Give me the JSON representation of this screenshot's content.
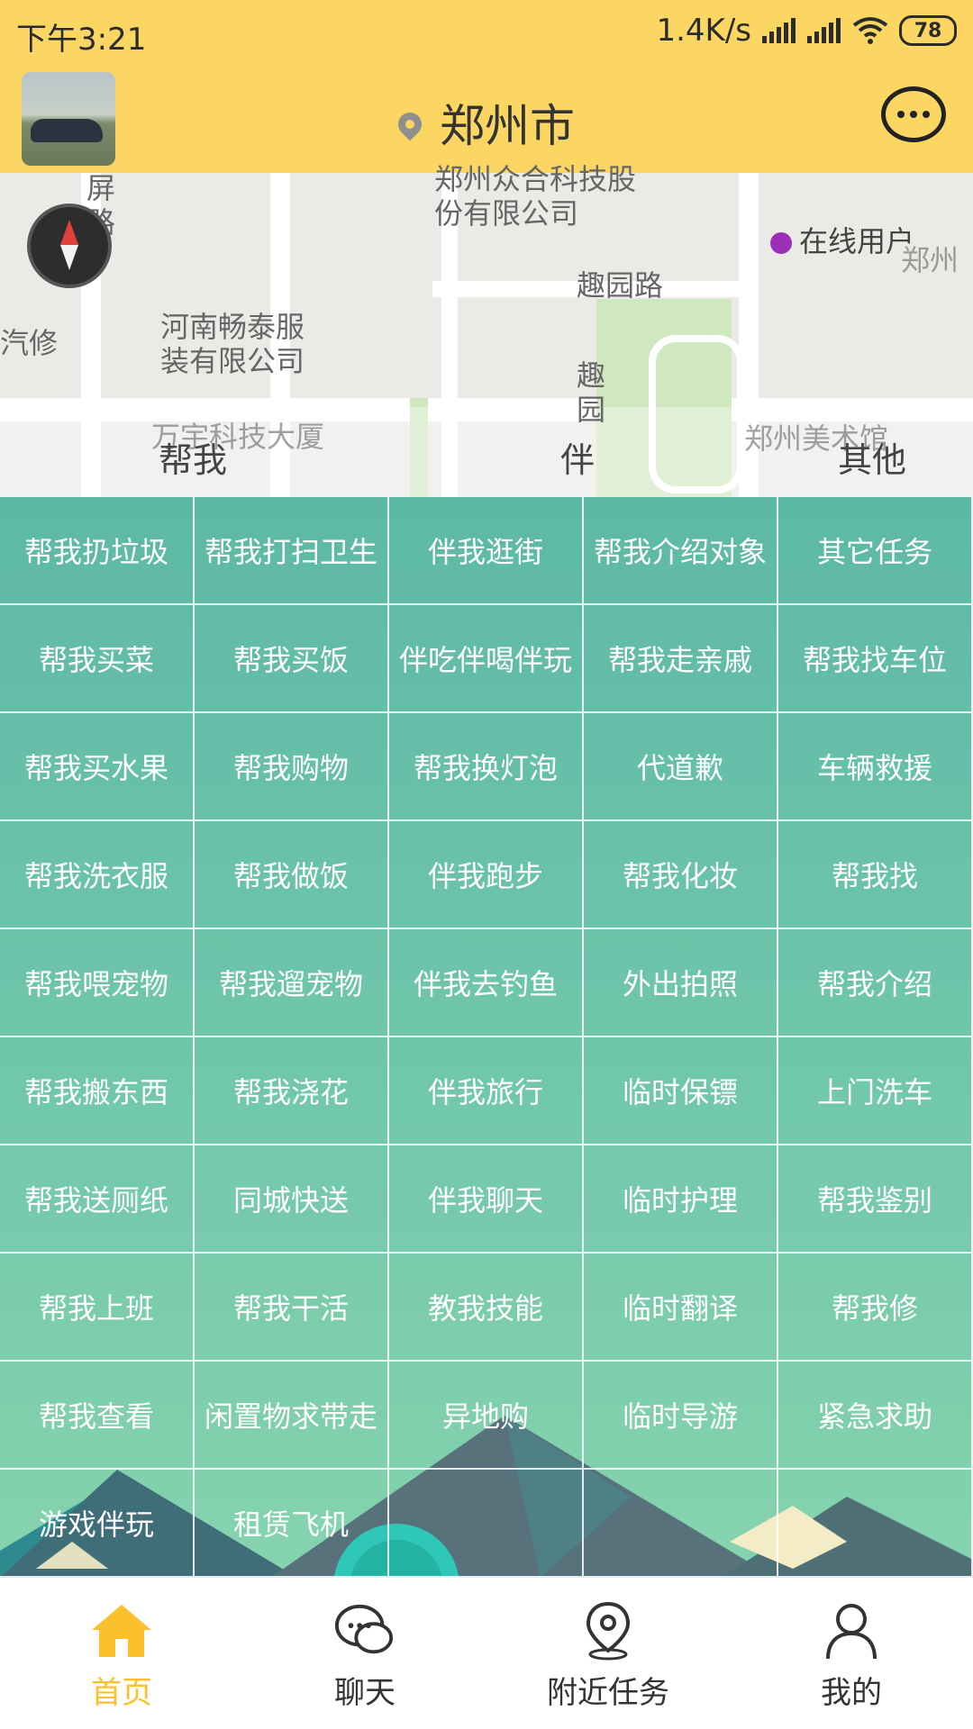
{
  "status_bar": {
    "time": "下午3:21",
    "network_speed": "1.4K/s",
    "battery": "78"
  },
  "header": {
    "city": "郑州市"
  },
  "map": {
    "labels": [
      "屏路",
      "郑州众合科技股份有限公司",
      "河南畅泰服装有限公司",
      "趣园路",
      "趣园",
      "汽修",
      "万宇科技大厦",
      "郑州美术馆",
      "郑州"
    ],
    "online_users": "在线用户",
    "categories": [
      "帮我",
      "伴",
      "其他"
    ]
  },
  "tasks": [
    "帮我扔垃圾",
    "帮我打扫卫生",
    "伴我逛街",
    "帮我介绍对象",
    "其它任务",
    "帮我买菜",
    "帮我买饭",
    "伴吃伴喝伴玩",
    "帮我走亲戚",
    "帮我找车位",
    "帮我买水果",
    "帮我购物",
    "帮我换灯泡",
    "代道歉",
    "车辆救援",
    "帮我洗衣服",
    "帮我做饭",
    "伴我跑步",
    "帮我化妆",
    "帮我找",
    "帮我喂宠物",
    "帮我遛宠物",
    "伴我去钓鱼",
    "外出拍照",
    "帮我介绍",
    "帮我搬东西",
    "帮我浇花",
    "伴我旅行",
    "临时保镖",
    "上门洗车",
    "帮我送厕纸",
    "同城快送",
    "伴我聊天",
    "临时护理",
    "帮我鉴别",
    "帮我上班",
    "帮我干活",
    "教我技能",
    "临时翻译",
    "帮我修",
    "帮我查看",
    "闲置物求带走",
    "异地购",
    "临时导游",
    "紧急求助",
    "游戏伴玩",
    "租赁飞机",
    "",
    "",
    ""
  ],
  "nav": [
    {
      "label": "首页",
      "icon": "home-icon",
      "active": true
    },
    {
      "label": "聊天",
      "icon": "chat-icon",
      "active": false
    },
    {
      "label": "附近任务",
      "icon": "location-icon",
      "active": false
    },
    {
      "label": "我的",
      "icon": "user-icon",
      "active": false
    }
  ],
  "colors": {
    "accent": "#fcd663",
    "active_nav": "#fbc02d",
    "grid_top": "#5db8a6",
    "grid_bottom": "#86d3ae"
  }
}
